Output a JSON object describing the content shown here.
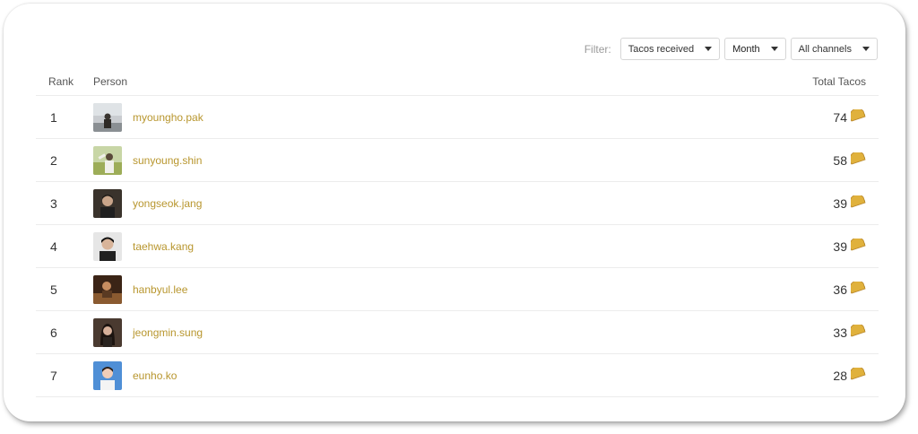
{
  "filters": {
    "label": "Filter:",
    "type_selected": "Tacos received",
    "period_selected": "Month",
    "channel_selected": "All channels"
  },
  "table": {
    "headers": {
      "rank": "Rank",
      "person": "Person",
      "total": "Total Tacos"
    },
    "rows": [
      {
        "rank": "1",
        "name": "myoungho.pak",
        "total": "74"
      },
      {
        "rank": "2",
        "name": "sunyoung.shin",
        "total": "58"
      },
      {
        "rank": "3",
        "name": "yongseok.jang",
        "total": "39"
      },
      {
        "rank": "4",
        "name": "taehwa.kang",
        "total": "39"
      },
      {
        "rank": "5",
        "name": "hanbyul.lee",
        "total": "36"
      },
      {
        "rank": "6",
        "name": "jeongmin.sung",
        "total": "33"
      },
      {
        "rank": "7",
        "name": "eunho.ko",
        "total": "28"
      }
    ]
  },
  "colors": {
    "name_link": "#b8962e",
    "taco_shell": "#e0b13c",
    "taco_filling": "#6a8a2a"
  },
  "icons": {
    "taco": "taco-icon",
    "caret": "caret-down-icon"
  }
}
